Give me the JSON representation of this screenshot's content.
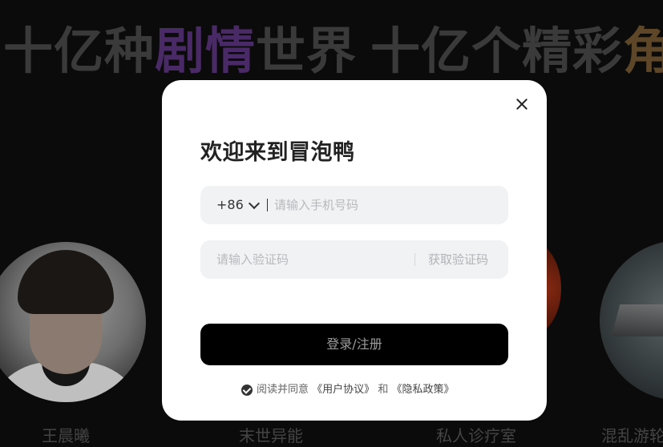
{
  "background": {
    "banner_left": [
      "十亿种",
      "剧情",
      "世界"
    ],
    "banner_right": [
      "十亿个精彩",
      "角"
    ],
    "characters": [
      "王晨曦",
      "末世异能",
      "私人诊疗室",
      "混乱游轮"
    ]
  },
  "modal": {
    "title": "欢迎来到冒泡鸭",
    "country_code": "+86",
    "phone_placeholder": "请输入手机号码",
    "code_placeholder": "请输入验证码",
    "get_code_label": "获取验证码",
    "submit_label": "登录/注册",
    "agree_prefix": "阅读并同意",
    "user_agreement": "《用户协议》",
    "agree_and": "和",
    "privacy_policy": "《隐私政策》"
  },
  "colors": {
    "accent_purple": "#4a2a66",
    "accent_gold": "#5e4628",
    "button_bg": "#000000"
  },
  "icons": [
    "close-icon",
    "chevron-down-icon",
    "check-circle-icon"
  ]
}
